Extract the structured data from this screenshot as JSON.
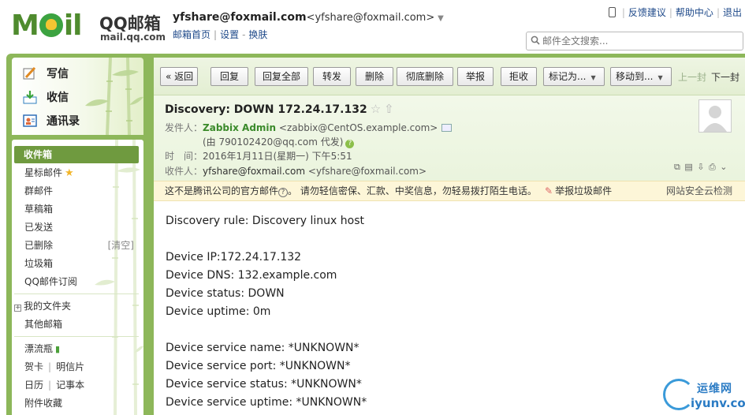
{
  "header": {
    "logo_word": "MOil",
    "brand": "QQ邮箱",
    "domain": "mail.qq.com",
    "account_name": "yfshare@foxmail.com",
    "account_addr": "<yfshare@foxmail.com>",
    "links": [
      "邮箱首页",
      "设置",
      "换肤"
    ],
    "top_links": [
      "反馈建议",
      "帮助中心",
      "退出"
    ],
    "search_placeholder": "邮件全文搜索..."
  },
  "sidebar": {
    "commands": [
      "写信",
      "收信",
      "通讯录"
    ],
    "folders": {
      "inbox": "收件箱",
      "starred": "星标邮件",
      "group": "群邮件",
      "drafts": "草稿箱",
      "sent": "已发送",
      "deleted": "已删除",
      "deleted_action": "[清空]",
      "spam": "垃圾箱",
      "subscribe": "QQ邮件订阅",
      "my_folders": "我的文件夹",
      "other_mailbox": "其他邮箱",
      "drift": "漂流瓶",
      "card": "贺卡",
      "postcard": "明信片",
      "calendar": "日历",
      "notebook": "记事本",
      "attachments": "附件收藏"
    }
  },
  "toolbar": {
    "back": "« 返回",
    "reply": "回复",
    "reply_all": "回复全部",
    "forward": "转发",
    "delete": "删除",
    "delete_forever": "彻底删除",
    "report": "举报",
    "reject": "拒收",
    "mark_as": "标记为...",
    "move_to": "移动到...",
    "prev": "上一封",
    "next": "下一封"
  },
  "mail": {
    "subject": "Discovery: DOWN 172.24.17.132",
    "sender_label": "发件人：",
    "sender_name": "Zabbix Admin",
    "sender_addr": "<zabbix@CentOS.example.com>",
    "proxy_note": "(由 790102420@qq.com 代发)",
    "time_label": "时　间：",
    "time_value": "2016年1月11日(星期一) 下午5:51",
    "to_label": "收件人：",
    "to_name": "yfshare@foxmail.com",
    "to_addr": "<yfshare@foxmail.com>"
  },
  "warning": {
    "text1": "这不是腾讯公司的官方邮件",
    "text2": "。 请勿轻信密保、汇款、中奖信息，勿轻易拨打陌生电话。",
    "report": "举报垃圾邮件",
    "check": "网站安全云检测"
  },
  "body": {
    "lines": [
      "Discovery rule: Discovery linux host",
      "",
      "Device IP:172.24.17.132",
      "Device DNS: 132.example.com",
      "Device status: DOWN",
      "Device uptime: 0m",
      "",
      "Device service name: *UNKNOWN*",
      "Device service port: *UNKNOWN*",
      "Device service status: *UNKNOWN*",
      "Device service uptime: *UNKNOWN*"
    ]
  },
  "watermark": {
    "cn": "运维网",
    "url": "iyunv.com"
  }
}
